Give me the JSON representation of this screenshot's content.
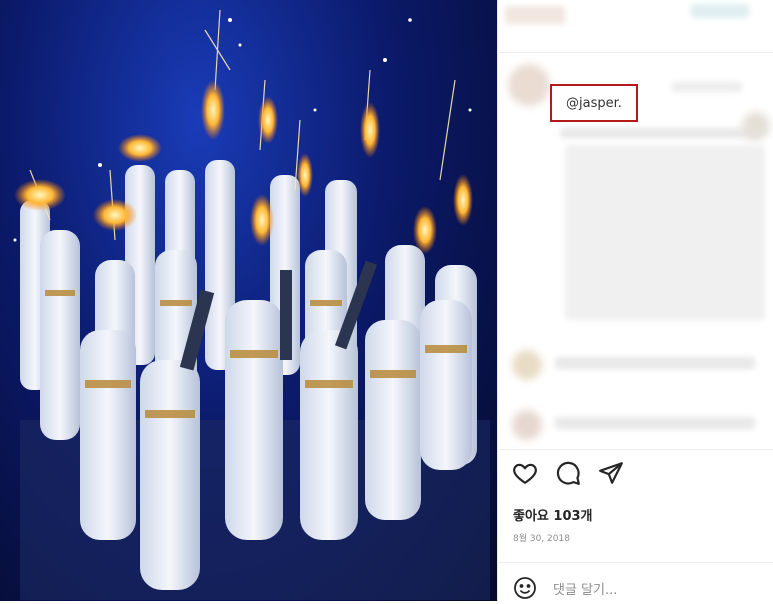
{
  "post": {
    "mention": "@jasper.",
    "likes": "좋아요 103개",
    "date": "8월 30, 2018"
  },
  "actions": {
    "like_icon": "heart-icon",
    "comment_icon": "comment-icon",
    "share_icon": "share-icon"
  },
  "comment": {
    "emoji_icon": "emoji-icon",
    "placeholder": "댓글 달기..."
  },
  "colors": {
    "highlight_border": "#b51a1a",
    "text_primary": "#262626",
    "text_secondary": "#8e8e8e"
  }
}
